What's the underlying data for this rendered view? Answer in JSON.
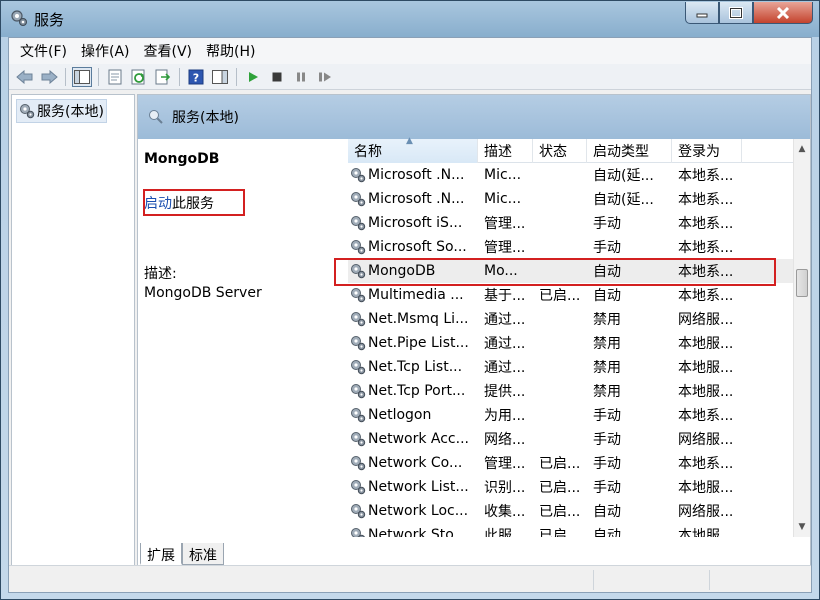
{
  "window": {
    "title": "服务"
  },
  "menu": [
    "文件(F)",
    "操作(A)",
    "查看(V)",
    "帮助(H)"
  ],
  "tree": {
    "root": "服务(本地)"
  },
  "pane": {
    "header": "服务(本地)"
  },
  "detail": {
    "service_name": "MongoDB",
    "start_link": "启动",
    "start_suffix": "此服务",
    "desc_label": "描述:",
    "desc_text": "MongoDB Server"
  },
  "columns": [
    "名称",
    "描述",
    "状态",
    "启动类型",
    "登录为"
  ],
  "rows": [
    [
      "Microsoft .N...",
      "Mic...",
      "",
      "自动(延...",
      "本地系..."
    ],
    [
      "Microsoft .N...",
      "Mic...",
      "",
      "自动(延...",
      "本地系..."
    ],
    [
      "Microsoft iS...",
      "管理...",
      "",
      "手动",
      "本地系..."
    ],
    [
      "Microsoft So...",
      "管理...",
      "",
      "手动",
      "本地系..."
    ],
    [
      "MongoDB",
      "Mo...",
      "",
      "自动",
      "本地系..."
    ],
    [
      "Multimedia ...",
      "基于...",
      "已启...",
      "自动",
      "本地系..."
    ],
    [
      "Net.Msmq Li...",
      "通过...",
      "",
      "禁用",
      "网络服..."
    ],
    [
      "Net.Pipe List...",
      "通过...",
      "",
      "禁用",
      "本地服..."
    ],
    [
      "Net.Tcp List...",
      "通过...",
      "",
      "禁用",
      "本地服..."
    ],
    [
      "Net.Tcp Port...",
      "提供...",
      "",
      "禁用",
      "本地服..."
    ],
    [
      "Netlogon",
      "为用...",
      "",
      "手动",
      "本地系..."
    ],
    [
      "Network Acc...",
      "网络...",
      "",
      "手动",
      "网络服..."
    ],
    [
      "Network Co...",
      "管理...",
      "已启...",
      "手动",
      "本地系..."
    ],
    [
      "Network List...",
      "识别...",
      "已启...",
      "手动",
      "本地服..."
    ],
    [
      "Network Loc...",
      "收集...",
      "已启...",
      "自动",
      "网络服..."
    ],
    [
      "Network Sto...",
      "此服...",
      "已启...",
      "自动",
      "本地服..."
    ]
  ],
  "tabs": [
    "扩展",
    "标准"
  ],
  "colors": {
    "highlight_box": "#d32020",
    "link": "#1a4fb0",
    "header_bg": "#9cbbd8"
  }
}
